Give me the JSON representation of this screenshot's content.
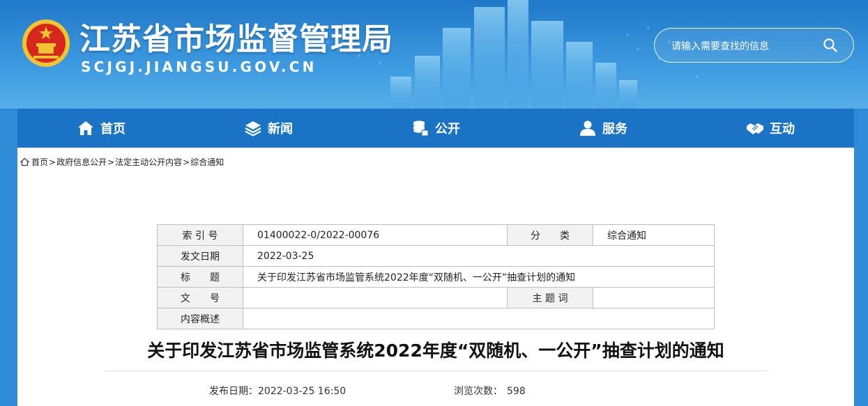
{
  "header": {
    "title": "江苏省市场监督管理局",
    "domain": "SCJGJ.JIANGSU.GOV.CN",
    "search_placeholder": "请输入需要查找的信息"
  },
  "colors": {
    "header_blue": "#2f8bd6",
    "nav_blue": "#1a73c4",
    "emblem_red": "#d7261c",
    "emblem_gold": "#f4c430"
  },
  "nav": {
    "items": [
      {
        "label": "首页",
        "icon": "home-icon"
      },
      {
        "label": "新闻",
        "icon": "layers-icon"
      },
      {
        "label": "公开",
        "icon": "database-icon"
      },
      {
        "label": "服务",
        "icon": "user-icon"
      },
      {
        "label": "互动",
        "icon": "handshake-icon"
      }
    ]
  },
  "breadcrumb": {
    "items": [
      "首页",
      "政府信息公开",
      "法定主动公开内容",
      "综合通知"
    ],
    "separator": ">"
  },
  "meta": {
    "index_label": "索 引 号",
    "index_value": "01400022-0/2022-00076",
    "category_label": "分　　类",
    "category_value": "综合通知",
    "date_label": "发文日期",
    "date_value": "2022-03-25",
    "title_label": "标　　题",
    "title_value": "关于印发江苏省市场监管系统2022年度“双随机、一公开”抽查计划的通知",
    "doc_no_label": "文　　号",
    "doc_no_value": "",
    "subject_label": "主 题 词",
    "subject_value": "",
    "summary_label": "内容概述",
    "summary_value": ""
  },
  "article": {
    "title": "关于印发江苏省市场监管系统2022年度“双随机、一公开”抽查计划的通知",
    "pub_date_label": "发布日期：",
    "pub_date_value": "2022-03-25 16:50",
    "views_label": "浏览次数：",
    "views_value": "598"
  }
}
